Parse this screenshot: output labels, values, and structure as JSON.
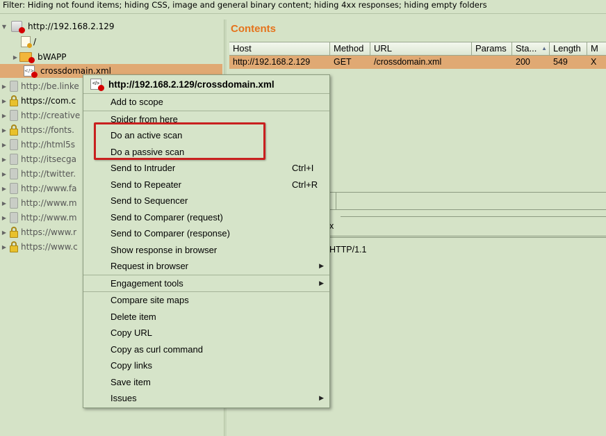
{
  "filter_text": "Filter: Hiding not found items;  hiding CSS, image and general binary content;  hiding 4xx responses;  hiding empty folders",
  "tree": {
    "items": [
      {
        "label": "http://192.168.2.129"
      },
      {
        "label": "/"
      },
      {
        "label": "bWAPP"
      },
      {
        "label": "crossdomain.xml"
      },
      {
        "label": "http://be.linke"
      },
      {
        "label": "https://com.c"
      },
      {
        "label": "http://creative"
      },
      {
        "label": "https://fonts."
      },
      {
        "label": "http://html5s"
      },
      {
        "label": "http://itsecga"
      },
      {
        "label": "http://twitter."
      },
      {
        "label": "http://www.fa"
      },
      {
        "label": "http://www.m"
      },
      {
        "label": "http://www.m"
      },
      {
        "label": "https://www.r"
      },
      {
        "label": "https://www.c"
      }
    ]
  },
  "contents": {
    "title": "Contents",
    "columns": [
      "Host",
      "Method",
      "URL",
      "Params",
      "Sta...",
      "Length",
      "M"
    ],
    "sort_indicator": "▲",
    "rows": [
      {
        "host": "http://192.168.2.129",
        "method": "GET",
        "url": "/crossdomain.xml",
        "params": "",
        "status": "200",
        "length": "549",
        "m": "X"
      }
    ]
  },
  "lower_panel": {
    "tab_x": "x",
    "request_line": "HTTP/1.1"
  },
  "context_menu": {
    "header": "http://192.168.2.129/crossdomain.xml",
    "items": [
      {
        "label": "Add to scope"
      },
      {
        "label": "Spider from here"
      },
      {
        "label": "Do an active scan"
      },
      {
        "label": "Do a passive scan"
      },
      {
        "label": "Send to Intruder",
        "shortcut": "Ctrl+I"
      },
      {
        "label": "Send to Repeater",
        "shortcut": "Ctrl+R"
      },
      {
        "label": "Send to Sequencer"
      },
      {
        "label": "Send to Comparer (request)"
      },
      {
        "label": "Send to Comparer (response)"
      },
      {
        "label": "Show response in browser"
      },
      {
        "label": "Request in browser",
        "submenu": "▶"
      },
      {
        "label": "Engagement tools",
        "submenu": "▶"
      },
      {
        "label": "Compare site maps"
      },
      {
        "label": "Delete item"
      },
      {
        "label": "Copy URL"
      },
      {
        "label": "Copy as curl command"
      },
      {
        "label": "Copy links"
      },
      {
        "label": "Save item"
      },
      {
        "label": "Issues",
        "submenu": "▶"
      }
    ]
  },
  "colors": {
    "background": "#d5e3c7",
    "selection": "#e0a973",
    "accent_title": "#e5731c",
    "highlight_box": "#c9201f",
    "status_dot": "#d40000"
  }
}
